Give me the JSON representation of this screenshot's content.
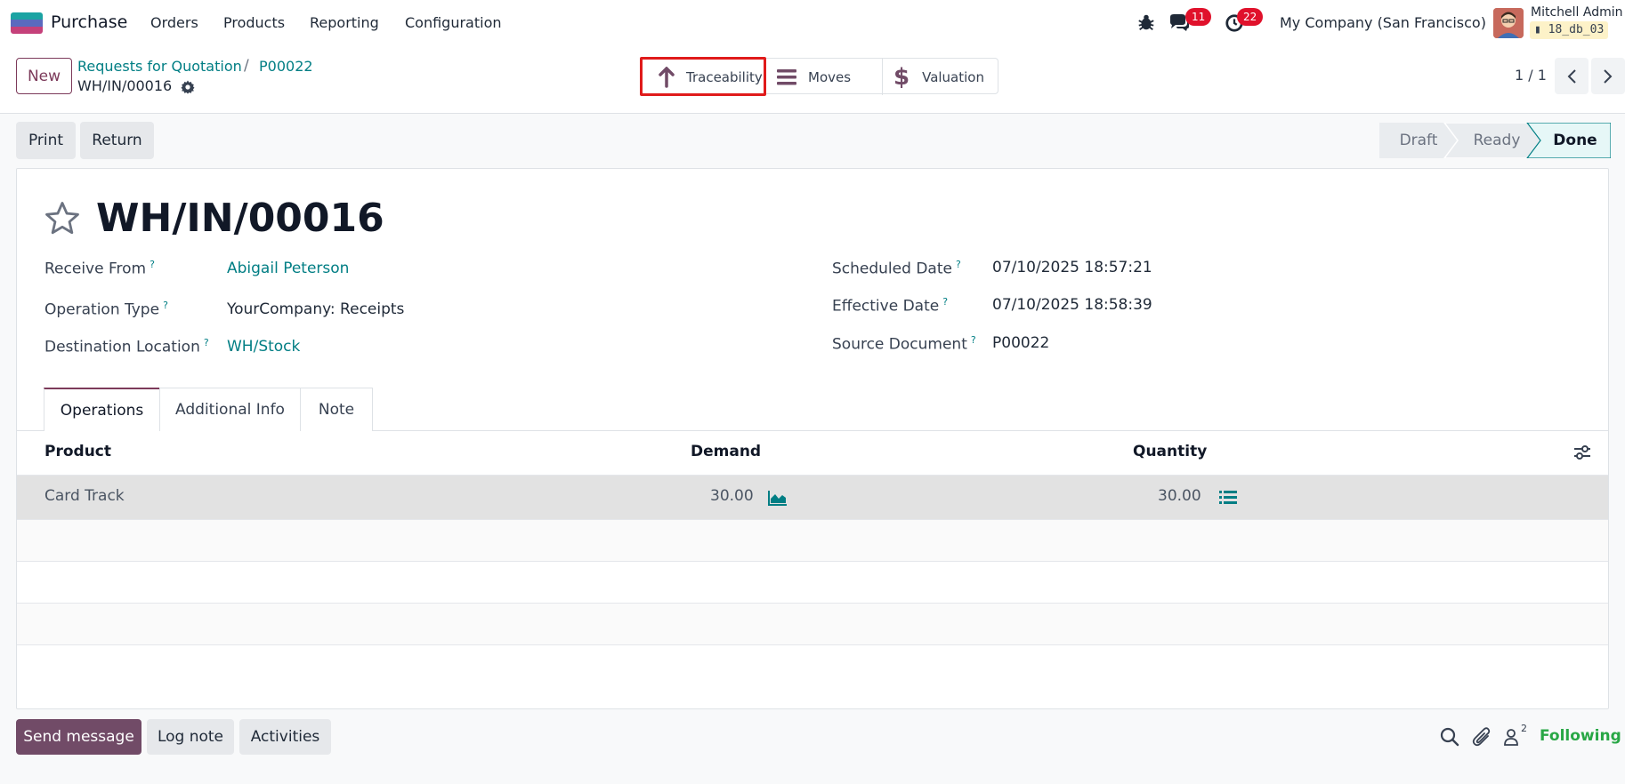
{
  "navbar": {
    "app_name": "Purchase",
    "menu": [
      "Orders",
      "Products",
      "Reporting",
      "Configuration"
    ],
    "messages_count": "11",
    "activities_count": "22",
    "company": "My Company (San Francisco)",
    "user_name": "Mitchell Admin",
    "db_name": "18_db_03"
  },
  "control": {
    "new_label": "New",
    "breadcrumb": [
      "Requests for Quotation",
      "P00022"
    ],
    "breadcrumb_sep": "/",
    "current_record": "WH/IN/00016",
    "smart_buttons": [
      "Traceability",
      "Moves",
      "Valuation"
    ],
    "pager": "1 / 1"
  },
  "actions": {
    "print": "Print",
    "return": "Return"
  },
  "status": {
    "steps": [
      "Draft",
      "Ready",
      "Done"
    ],
    "current": "Done"
  },
  "record": {
    "title": "WH/IN/00016",
    "fields_left": [
      {
        "label": "Receive From",
        "value": "Abigail Peterson"
      },
      {
        "label": "Operation Type",
        "value": "YourCompany: Receipts"
      },
      {
        "label": "Destination Location",
        "value": "WH/Stock"
      }
    ],
    "fields_right": [
      {
        "label": "Scheduled Date",
        "value": "07/10/2025 18:57:21"
      },
      {
        "label": "Effective Date",
        "value": "07/10/2025 18:58:39"
      },
      {
        "label": "Source Document",
        "value": "P00022"
      }
    ],
    "help_mark": "?"
  },
  "tabs": [
    "Operations",
    "Additional Info",
    "Note"
  ],
  "table": {
    "headers": [
      "Product",
      "Demand",
      "Quantity"
    ],
    "rows": [
      {
        "product": "Card Track",
        "demand": "30.00",
        "quantity": "30.00"
      }
    ]
  },
  "chatter": {
    "send_message": "Send message",
    "log_note": "Log note",
    "activities": "Activities",
    "followers_count": "2",
    "following": "Following"
  },
  "colors": {
    "brand": "#714b67",
    "link": "#017e84",
    "highlight": "#e01b1b",
    "following": "#28a745"
  }
}
